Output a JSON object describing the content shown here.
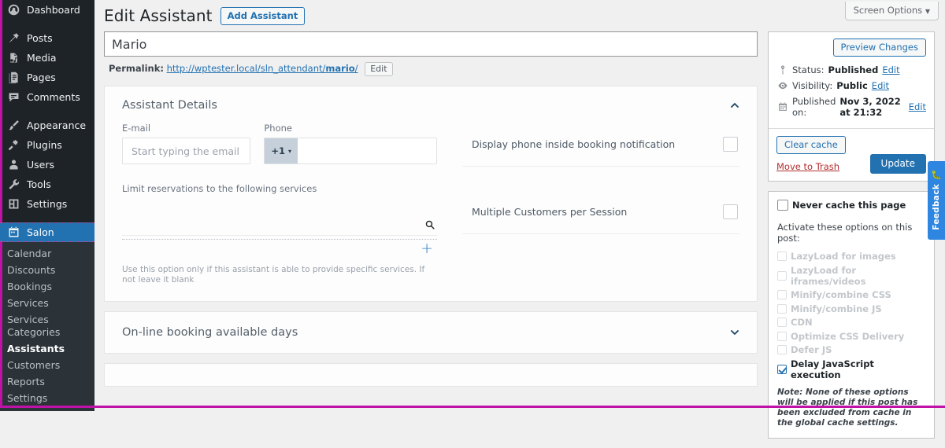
{
  "sidebar": {
    "items": [
      {
        "label": "Dashboard",
        "icon": "dashboard-icon"
      },
      {
        "label": "Posts",
        "icon": "pin-icon"
      },
      {
        "label": "Media",
        "icon": "media-icon"
      },
      {
        "label": "Pages",
        "icon": "pages-icon"
      },
      {
        "label": "Comments",
        "icon": "comments-icon"
      },
      {
        "label": "Appearance",
        "icon": "brush-icon"
      },
      {
        "label": "Plugins",
        "icon": "plugins-icon"
      },
      {
        "label": "Users",
        "icon": "users-icon"
      },
      {
        "label": "Tools",
        "icon": "wrench-icon"
      },
      {
        "label": "Settings",
        "icon": "gear-icon"
      }
    ],
    "current": {
      "label": "Salon",
      "icon": "calendar-icon"
    },
    "submenu": [
      {
        "label": "Calendar",
        "active": false
      },
      {
        "label": "Discounts",
        "active": false
      },
      {
        "label": "Bookings",
        "active": false
      },
      {
        "label": "Services",
        "active": false
      },
      {
        "label": "Services Categories",
        "active": false
      },
      {
        "label": "Assistants",
        "active": true
      },
      {
        "label": "Customers",
        "active": false
      },
      {
        "label": "Reports",
        "active": false
      },
      {
        "label": "Settings",
        "active": false
      }
    ]
  },
  "screen_options": {
    "label": "Screen Options",
    "caret": "▼"
  },
  "header": {
    "title": "Edit Assistant",
    "add_button": "Add Assistant"
  },
  "title_field": {
    "value": "Mario"
  },
  "permalink": {
    "label": "Permalink:",
    "base": "http://wptester.local/sln_attendant/",
    "slug": "mario",
    "trailing": "/",
    "edit_button": "Edit"
  },
  "details_panel": {
    "title": "Assistant Details",
    "chevron": "chevron-up-icon",
    "email": {
      "label": "E-mail",
      "placeholder": "Start typing the email",
      "value": ""
    },
    "phone": {
      "label": "Phone",
      "prefix": "+1",
      "caret": "▾",
      "value": "",
      "placeholder": ""
    },
    "limit_services": {
      "label": "Limit reservations to the following services",
      "search_icon": "search-icon",
      "add_icon": "plus-icon",
      "hint": "Use this option only if this assistant is able to provide specific services. If not leave it blank"
    },
    "options": [
      {
        "label": "Display phone inside booking notification",
        "checked": false
      },
      {
        "label": "Multiple Customers per Session",
        "checked": false
      }
    ]
  },
  "booking_days_panel": {
    "title": "On-line booking available days",
    "chevron": "chevron-down-icon"
  },
  "publish_box": {
    "preview_button": "Preview Changes",
    "status": {
      "icon": "pin-icon",
      "label": "Status:",
      "value": "Published",
      "edit": "Edit"
    },
    "visibility": {
      "icon": "eye-icon",
      "label": "Visibility:",
      "value": "Public",
      "edit": "Edit"
    },
    "published_on": {
      "icon": "calendar-icon",
      "label": "Published on:",
      "value": "Nov 3, 2022 at 21:32",
      "edit": "Edit"
    },
    "clear_cache_button": "Clear cache",
    "trash_link": "Move to Trash",
    "update_button": "Update"
  },
  "cache_box": {
    "never_cache": {
      "label": "Never cache this page",
      "checked": false
    },
    "lead": "Activate these options on this post:",
    "options": [
      {
        "label": "LazyLoad for images",
        "checked": false,
        "enabled": false
      },
      {
        "label": "LazyLoad for iframes/videos",
        "checked": false,
        "enabled": false
      },
      {
        "label": "Minify/combine CSS",
        "checked": false,
        "enabled": false
      },
      {
        "label": "Minify/combine JS",
        "checked": false,
        "enabled": false
      },
      {
        "label": "CDN",
        "checked": false,
        "enabled": false
      },
      {
        "label": "Optimize CSS Delivery",
        "checked": false,
        "enabled": false
      },
      {
        "label": "Defer JS",
        "checked": false,
        "enabled": false
      },
      {
        "label": "Delay JavaScript execution",
        "checked": true,
        "enabled": true
      }
    ],
    "note": "Note: None of these options will be applied if this post has been excluded from cache in the global cache settings."
  },
  "feedback_tab": {
    "label": "Feedback",
    "icon": "bug-icon"
  },
  "colors": {
    "wp_blue": "#2271b1",
    "admin_bg": "#f0f0f1",
    "menu_bg": "#1d2327",
    "submenu_bg": "#2c3338",
    "accent_magenta": "#c012a6",
    "phone_prefix_bg": "#c6d0da",
    "trash_red": "#b32d2e",
    "feedback_blue": "#2e86e0"
  }
}
